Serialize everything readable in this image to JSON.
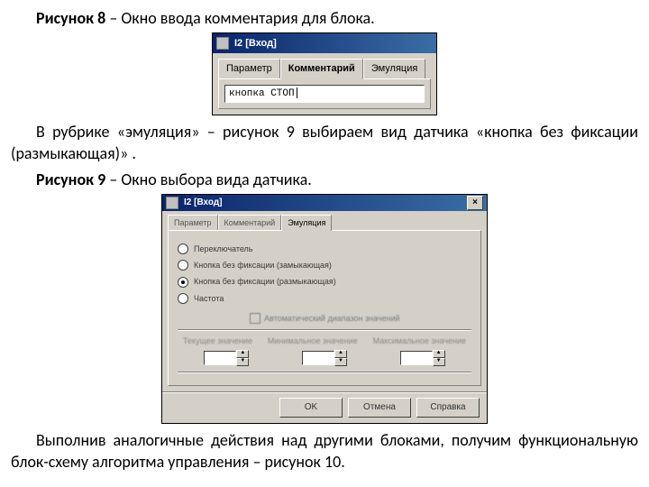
{
  "fig8": {
    "caption_bold": "Рисунок 8",
    "caption_rest": " – Окно ввода комментария для блока.",
    "title": "I2 [Вход]",
    "tabs": [
      "Параметр",
      "Комментарий",
      "Эмуляция"
    ],
    "field_value": "кнопка СТОП"
  },
  "para1_a": "В рубрике «эмуляция» – рисунок 9 выбираем вид датчика «кнопка без фиксации (размыкающая)» .",
  "fig9": {
    "caption_bold": "Рисунок 9",
    "caption_rest": " – Окно выбора вида датчика.",
    "title": "I2 [Вход]",
    "tabs": [
      "Параметр",
      "Комментарий",
      "Эмуляция"
    ],
    "radios": [
      {
        "label": "Переключатель",
        "selected": false
      },
      {
        "label": "Кнопка без фиксации (замыкающая)",
        "selected": false
      },
      {
        "label": "Кнопка без фиксации (размыкающая)",
        "selected": true
      },
      {
        "label": "Частота",
        "selected": false
      }
    ],
    "checkbox_label": "Автоматический диапазон значений",
    "col_labels": [
      "Текущее значение",
      "Минимальное значение",
      "Максимальное значение"
    ],
    "buttons": [
      "OK",
      "Отмена",
      "Справка"
    ]
  },
  "para2": "Выполнив аналогичные действия над другими блоками, получим функциональную блок-схему алгоритма управления – рисунок 10."
}
